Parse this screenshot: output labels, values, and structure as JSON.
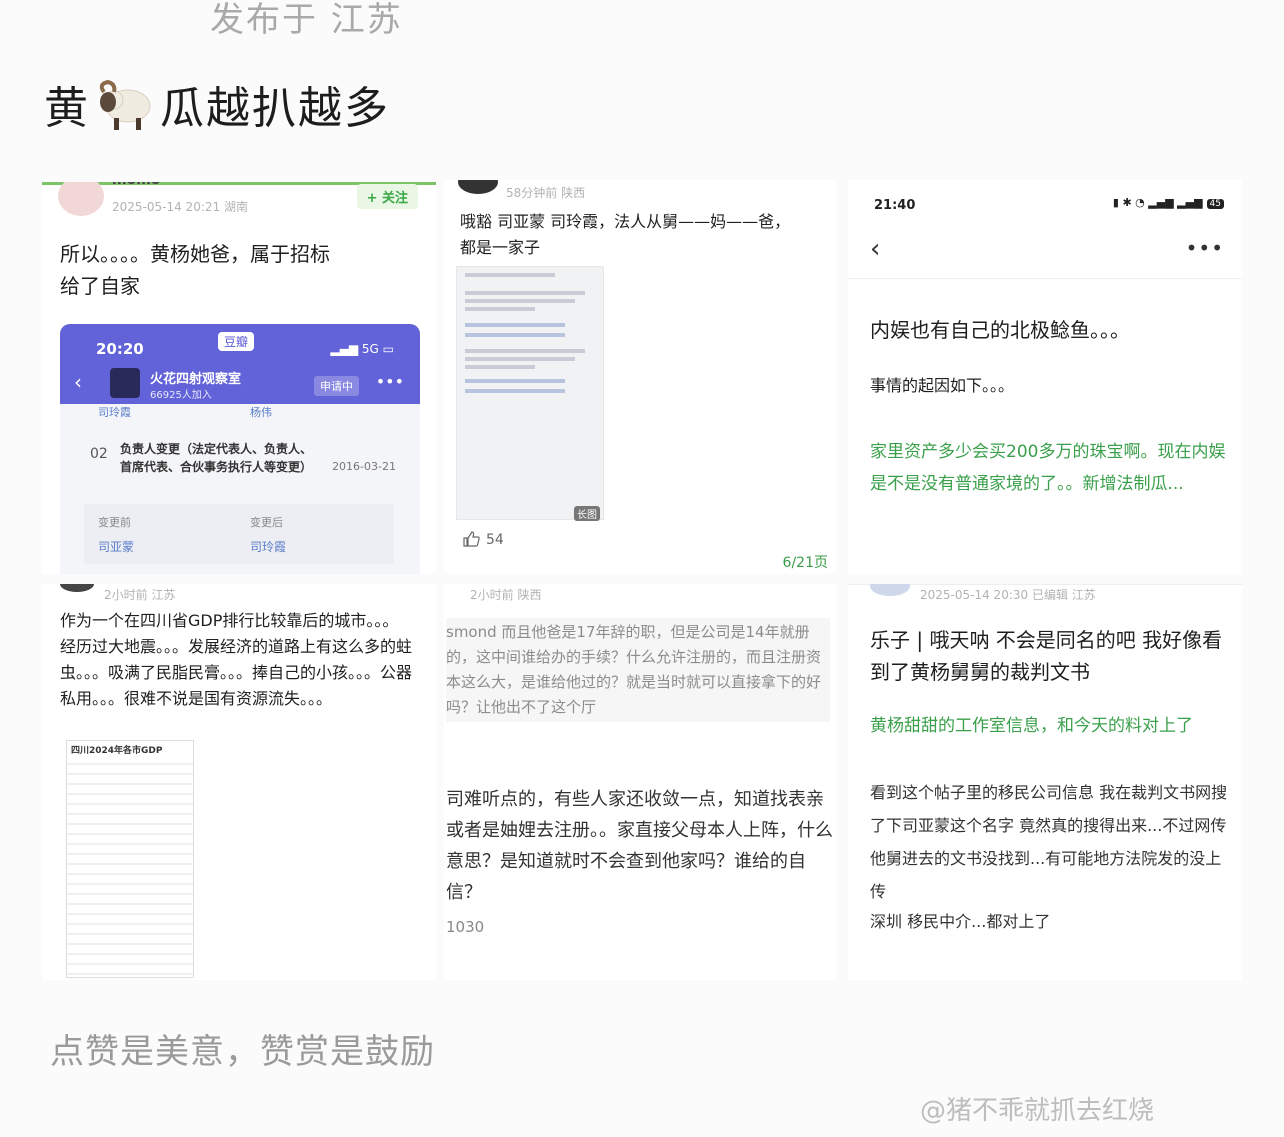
{
  "page": {
    "location": "发布于 江苏",
    "headline_left": "黄",
    "headline_right": "瓜越扒越多",
    "footer": "点赞是美意，赞赏是鼓励",
    "watermark": "@猪不乖就抓去红烧"
  },
  "cell1": {
    "name": "momo",
    "meta": "2025-05-14 20:21 湖南",
    "follow": "+ 关注",
    "text_line1": "所以。。。。黄杨她爸，属于招标",
    "text_line2": "给了自家",
    "inset": {
      "time": "20:20",
      "app": "豆瓣",
      "signal": "5G",
      "group_name": "火花四射观察室",
      "group_members": "66925人加入",
      "apply": "申请中",
      "name_a": "司玲霞",
      "name_b": "杨伟",
      "number": "02",
      "change": "负责人变更（法定代表人、负责人、首席代表、合伙事务执行人等变更）",
      "date": "2016-03-21",
      "before_label": "变更前",
      "after_label": "变更后",
      "before_value": "司亚蒙",
      "after_value": "司玲霞"
    }
  },
  "cell2": {
    "meta": "58分钟前 陕西",
    "text_line1": "哦豁 司亚蒙 司玲霞，法人从舅——妈——爸，",
    "text_line2": "都是一家子",
    "long_tag": "长图",
    "likes": "54",
    "page": "6/21页"
  },
  "cell3": {
    "status_time": "21:40",
    "battery": "45",
    "title": "内娱也有自己的北极鲶鱼。。。",
    "lead": "事情的起因如下。。。",
    "link": "家里资产多少会买200多万的珠宝啊。现在内娱是不是没有普通家境的了。。新增法制瓜..."
  },
  "cell4": {
    "meta": "2小时前 江苏",
    "text": "作为一个在四川省GDP排行比较靠后的城市。。。经历过大地震。。。发展经济的道路上有这么多的蛀虫。。。吸满了民脂民膏。。。捧自己的小孩。。。公器私用。。。很难不说是国有资源流失。。。",
    "table_title": "四川2024年各市GDP"
  },
  "cell5": {
    "meta": "2小时前 陕西",
    "quote": "smond 而且他爸是17年辞的职，但是公司是14年就册的，这中间谁给办的手续？什么允许注册的，而且注册资本这么大，是谁给他过的？就是当时就可以直接拿下的好吗？让他出不了这个厅",
    "reply": "司难听点的，有些人家还收敛一点，知道找表亲或者是妯娌去注册。。家直接父母本人上阵，什么意思？是知道就时不会查到他家吗？谁给的自信？",
    "count": "1030"
  },
  "cell6": {
    "meta": "2025-05-14 20:30 已编辑 江苏",
    "title": "乐子 | 哦天呐 不会是同名的吧 我好像看到了黄杨舅舅的裁判文书",
    "link": "黄杨甜甜的工作室信息，和今天的料对上了",
    "body": "看到这个帖子里的移民公司信息 我在裁判文书网搜了下司亚蒙这个名字 竟然真的搜得出来...不过网传他舅进去的文书没找到...有可能地方法院发的没上传",
    "closing": "深圳 移民中介...都对上了"
  }
}
